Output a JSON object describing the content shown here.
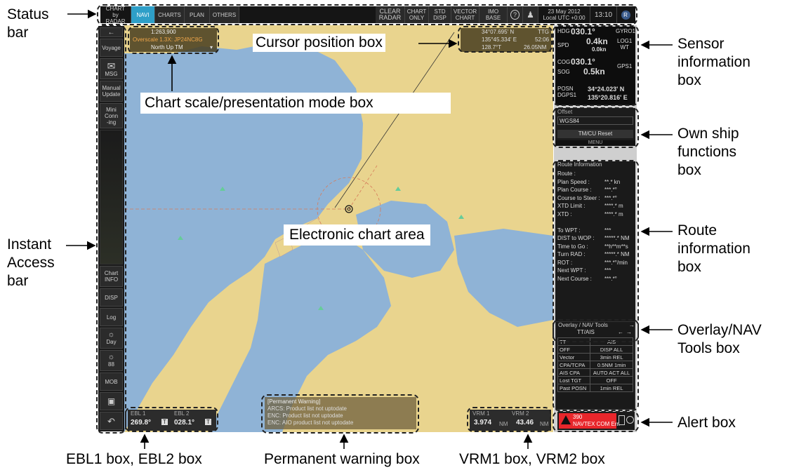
{
  "status_bar": {
    "chart_radar": "CHART\nby RADAR",
    "tabs": [
      "NAVI",
      "CHARTS",
      "PLAN",
      "OTHERS"
    ],
    "active_tab": "NAVI",
    "clear_radar": "CLEAR\nRADAR",
    "chart_only": "CHART\nONLY",
    "std_disp": "STD\nDISP",
    "vector_chart": "VECTOR\nCHART",
    "imo_base": "IMO\nBASE",
    "date": "23 May 2012",
    "utc": "Local UTC +0:00",
    "time": "13:10"
  },
  "instant_access": {
    "voyage": "Voyage",
    "msg": "MSG",
    "manual_update": "Manual\nUpdate",
    "mini_conning": "Mini\nConn\n-ing",
    "chart_info": "Chart\nINFO",
    "disp": "DISP",
    "log": "Log",
    "day": "Day",
    "brightness": "88",
    "mob": "MOB"
  },
  "scale_box": {
    "scale": "1:263,900",
    "overscale": "Overscale 1.3X: JP24NC8G",
    "mode": "North Up TM"
  },
  "cursor_box": {
    "lat": "34°07.695' N",
    "lon": "135°45.334' E",
    "ttg": "TTG",
    "ttg_value": "52:06",
    "brg": "128.7°T",
    "rng": "26.05NM"
  },
  "sensor_box": {
    "hdg_label": "HDG",
    "hdg": "030.1°",
    "gyro": "GYRO1",
    "spd_label": "SPD",
    "spd": "0.4kn",
    "spd_sub": "0.0kn",
    "log": "LOG1\nWT",
    "cog_label": "COG",
    "cog": "030.1°",
    "sog_label": "SOG",
    "sog": "0.5kn",
    "gps": "GPS1",
    "posn_label": "POSN\nDGPS1",
    "lat": "34°24.023' N",
    "lon": "135°20.816' E"
  },
  "own_ship_box": {
    "offset": "Offset",
    "datum": "WGS84",
    "reset": "TM/CU Reset",
    "menu": "MENU"
  },
  "route_box": {
    "title": "Route Information",
    "rows": [
      {
        "k": "Route :",
        "v": ""
      },
      {
        "k": "Plan Speed :",
        "v": "**.* kn"
      },
      {
        "k": "Plan Course :",
        "v": "***.*°"
      },
      {
        "k": "Course to Steer :",
        "v": "***.*°"
      },
      {
        "k": "XTD Limit :",
        "v": "****.* m"
      },
      {
        "k": "XTD :",
        "v": "****.* m"
      },
      {
        "k": "",
        "v": ""
      },
      {
        "k": "To WPT :",
        "v": "***"
      },
      {
        "k": "DIST to WOP :",
        "v": "*****.* NM"
      },
      {
        "k": "Time to Go :",
        "v": "**h**m**s"
      },
      {
        "k": "Turn RAD :",
        "v": "*****.* NM"
      },
      {
        "k": "ROT :",
        "v": "***.*°/min"
      },
      {
        "k": "Next WPT :",
        "v": "***"
      },
      {
        "k": "Next Course :",
        "v": "***.*°"
      }
    ]
  },
  "overlay_box": {
    "title": "Overlay / NAV Tools",
    "tab": "TT/AIS",
    "rows": [
      [
        "TT",
        "AIS"
      ],
      [
        "OFF",
        "DISP ALL"
      ],
      [
        "Vector",
        "3min REL"
      ],
      [
        "CPA/TCPA",
        "0.5NM 1min"
      ],
      [
        "AIS CPA",
        "AUTO ACT ALL"
      ],
      [
        "Lost TGT",
        "OFF"
      ],
      [
        "Past POSN",
        "1min REL"
      ]
    ]
  },
  "alert_box": {
    "number": "390",
    "text": "NAVTEX COM Err."
  },
  "ebl": {
    "ebl1_label": "EBL 1",
    "ebl1": "269.8°",
    "ebl2_label": "EBL 2",
    "ebl2": "028.1°",
    "mode": "T"
  },
  "vrm": {
    "vrm1_label": "VRM 1",
    "vrm1": "3.974",
    "vrm2_label": "VRM 2",
    "vrm2": "43.46",
    "unit": "NM"
  },
  "warning_box": {
    "title": "[Permanent Warning]",
    "lines": [
      "ARCS: Product list not uptodate",
      "ENC: Product list not uptodate",
      "ENC: AIO product list not uptodate"
    ]
  },
  "callouts": {
    "status_bar": "Status\nbar",
    "cursor_position": "Cursor position box",
    "sensor_info": "Sensor\ninformation\nbox",
    "chart_scale": "Chart scale/presentation mode box",
    "own_ship": "Own ship\nfunctions\nbox",
    "route_info": "Route\ninformation\nbox",
    "electronic_chart": "Electronic chart area",
    "instant_access": "Instant\nAccess\nbar",
    "overlay_nav": "Overlay/NAV\nTools box",
    "alert": "Alert box",
    "ebl": "EBL1 box, EBL2 box",
    "permanent_warning": "Permanent warning box",
    "vrm": "VRM1 box, VRM2 box"
  },
  "colors": {
    "sea": "#8fb3d6",
    "land": "#e9d48e",
    "nav_active": "#2e9fc8",
    "sensor_green": "#3de34d",
    "alert_red": "#e8262b"
  }
}
